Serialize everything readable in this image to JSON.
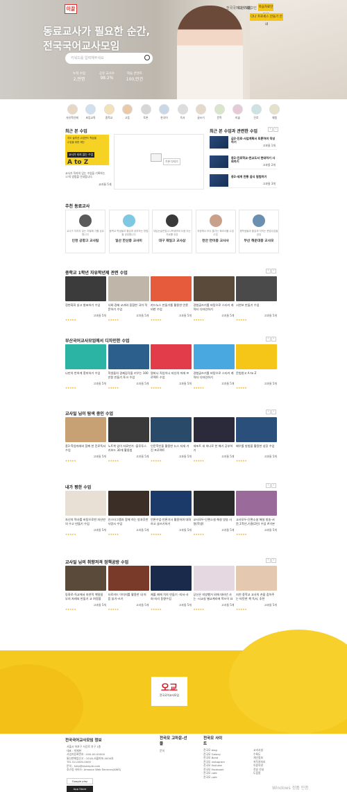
{
  "brand": {
    "logo_text": "이끌"
  },
  "header": {
    "nav_items": [
      "전국국어교사모임",
      "회원가입",
      "로그인"
    ],
    "cta_top": "학습자료만들기",
    "cta_sub": "다나 프로세스 만들기 안내",
    "title_line1": "동료교사가 필요한 순간,",
    "title_line2": "전국국어교사모임",
    "search_placeholder": "키워드를 입력해주세요",
    "stats": [
      {
        "label": "누적 수업",
        "value": "2,만명"
      },
      {
        "label": "공유 교사수",
        "value": "98.2%"
      },
      {
        "label": "학습 콘텐츠",
        "value": "100,만건"
      }
    ]
  },
  "categories": [
    "자유학년제",
    "초등교육",
    "중학교",
    "고등",
    "토론",
    "한국어",
    "독서",
    "글쓰기",
    "문학",
    "미술",
    "진로",
    "체험"
  ],
  "recent": {
    "title": "최근 본 수업",
    "banner_small": "지도 솔루션 수업만드 학습을",
    "banner_sub": "수업을 위한 재단",
    "banner_box": "교사가 되지 않는 수업",
    "banner_big": "A to Z",
    "desc": "교사가 직자의 입는 수업을 기록하는 17의 방법을 안내합니다.",
    "rating": "교과들 5개",
    "button": "기본 다지기"
  },
  "related": {
    "title": "최근 본 수업과 관련한 수업",
    "items": [
      {
        "title": "급2-진로-사업계획서 토론하여 작성하기",
        "rating": "고과들 1개"
      },
      {
        "title": "중2-진로학교-천교도서 현대하기 사회하기",
        "rating": "고과들 2개"
      },
      {
        "title": "중2-세계 전통 음식 탐험하기",
        "rating": "고과들 3개"
      }
    ]
  },
  "teachers": {
    "title": "추천 동료교사",
    "items": [
      {
        "desc": "교사가 지치지 않는 자필해 기를 공유합니다",
        "name": "인천 공항고 교사팀"
      },
      {
        "desc": "중학교 학생들과 즐겁게 공부하는 방법을 공유합니다",
        "name": "일산 한산중 교사이"
      },
      {
        "desc": "대입논술면접수시학생부에 도움 되는 자료를 공유",
        "name": "대구 재일고 교사삼"
      },
      {
        "desc": "과정에서 모두 즐기는 확라서를 수업 수업",
        "name": "천안 연이중 교사사"
      },
      {
        "desc": "중학생들과 즐겁게 익히는 문법수업을 공유",
        "name": "부산 해운대중 교사오"
      }
    ]
  },
  "sections": [
    {
      "title": "중학교 1학년 자유학년제 관련 수업",
      "cards": [
        {
          "title": "정변화화 읽고 발표하기 수업",
          "rating": "고과들 5개"
        },
        {
          "title": "사회·경제 교과와 융합한 국어 작문하기 수업",
          "rating": "고과들 5개"
        },
        {
          "title": "카드뉴스 만들기를 활용한 언론 비판 수업",
          "rating": "고과들 5개"
        },
        {
          "title": "경험글쓰기를 바탕으로 스티커 캐릭터 디자인하기",
          "rating": "고과들 5개"
        },
        {
          "title": "시연보 만들기 수업",
          "rating": "고과들 5개"
        }
      ]
    },
    {
      "title": "부산국어교사모임에서 디자인한 수업",
      "cards": [
        {
          "title": "나만의 반하게 흥미하기 수업",
          "rating": "고과들 5개"
        },
        {
          "title": "학생들의 경제감각을 키우는 100만원 만들기 토크 수업",
          "rating": "고과들 5개"
        },
        {
          "title": "알바나 직업이나 자신의 미래 프로젝트 수업",
          "rating": "고과들 5개"
        },
        {
          "title": "경험글쓰기를 바탕으로 스티커 캐릭터 디자인하기",
          "rating": "고과들 5개"
        },
        {
          "title": "문법창고 A to Z",
          "rating": "고과들 5개"
        }
      ]
    },
    {
      "title": "교사일 님이 탐색 중인 수업",
      "cards": [
        {
          "title": "중3·학업미래와 함께 한 진로독서 수업",
          "rating": "고과들 5개"
        },
        {
          "title": "노트북 없이 자료만가 -플루투스 키보드 30개 활용법",
          "rating": "고과들 5개"
        },
        {
          "title": "인문학인을 활용한 뉴스 자세 가진 프로젝트",
          "rating": "고과들 5개"
        },
        {
          "title": "레포트 새 하나로 한 해가 공부하기",
          "rating": "고과들 5개"
        },
        {
          "title": "배우를 방법을 활용한 성장 수업",
          "rating": "고과들 5개"
        }
      ]
    },
    {
      "title": "내가 평한 수업",
      "cards": [
        {
          "title": "자신의 역사를 바탕으로한 자신만의 수고 만들기 수업",
          "rating": "고과들 5개"
        },
        {
          "title": "인스타그램과 함께 하는 방과후반 사랑시 수업",
          "rating": "고과들 5개"
        },
        {
          "title": "언론수업-언론기사 활용하여 대화하고 글쓰기하기",
          "rating": "고과들 5개"
        },
        {
          "title": "교사모두-단편소설 해설 방송 사절(학생)",
          "rating": "고과들 5개"
        },
        {
          "title": "교사모두-단편소설 해설 방송-서문,1학년,기결(2인) 수업 #기본쓰기학습",
          "rating": "고과들 5개"
        }
      ]
    },
    {
      "title": "교사일 님의 취향저격 정책공방 수업",
      "cards": [
        {
          "title": "동화로-독교에서 자연적 책밀밀 부지 자래되 만들기 교 여정을",
          "rating": "고과들 5개"
        },
        {
          "title": "타로카드 이미지를 활용한 내 마음 읽기-쓰기",
          "rating": "고과들 5개"
        },
        {
          "title": "제출 제에 치의 만들기 -지서-사회-지리 동향수업",
          "rating": "고과들 5개"
        },
        {
          "title": "당신은 지방했거 외에 대비년 사는 -시교실 별교계리에 목쓰이 요로",
          "rating": "고과들 5개"
        },
        {
          "title": "지친 중학교 교사의 손을 잡아주는 따뜻한 책 독서, 추천",
          "rating": "고과들 5개"
        }
      ]
    }
  ],
  "footer": {
    "logo_text": "오교",
    "logo_sub": "전국국어교사모임",
    "org_title": "전국국어교사모임 정보",
    "org_lines": [
      "서울시 마포구 서강로 지구 1층",
      "대표 : 박체현",
      "사업자등록번호 : 000-00-00000",
      "통신판매업신고 : 2018-서울마포-0000호",
      "TEL 02-0000-0000",
      "문의 : help@example.com",
      "호스팅 서비스: Amazon Web Services(AWS)"
    ],
    "col2_title": "전국모 고마운-선물",
    "col2_sub": "문의",
    "col3_title": "전국모 사이트",
    "col3_links": [
      "전국모 blog",
      "전국모 Galaxy",
      "전국모 Band",
      "전국모 instagram",
      "전국모 Youtube",
      "전국모 Facebook",
      "전국모 cafe",
      "전국모 cafe"
    ],
    "col4_links": [
      "교과서설",
      "수록도",
      "개인정보",
      "저작권처리",
      "이용약관",
      "전송 안내",
      "도움말"
    ],
    "app1": "Google play",
    "app2": "App Store",
    "watermark": "Windows 정품 인증"
  }
}
